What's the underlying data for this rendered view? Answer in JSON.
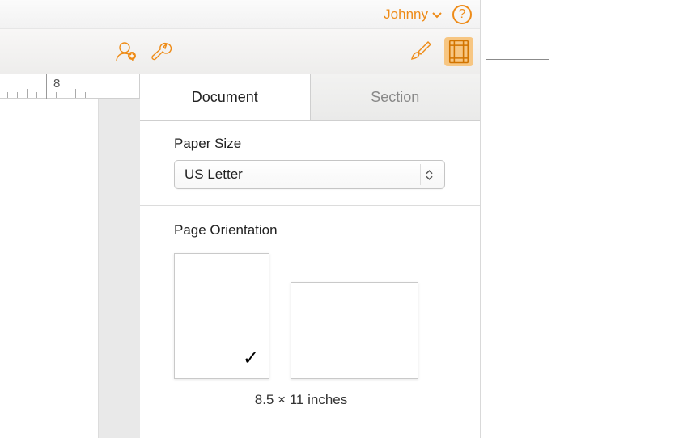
{
  "header": {
    "user_name": "Johnny",
    "help_glyph": "?"
  },
  "ruler": {
    "major_label": "8"
  },
  "inspector": {
    "tabs": {
      "document": "Document",
      "section": "Section"
    },
    "paper_size": {
      "label": "Paper Size",
      "value": "US Letter"
    },
    "orientation": {
      "label": "Page Orientation",
      "selected": "portrait",
      "dimensions": "8.5 × 11 inches",
      "check_glyph": "✓"
    }
  }
}
